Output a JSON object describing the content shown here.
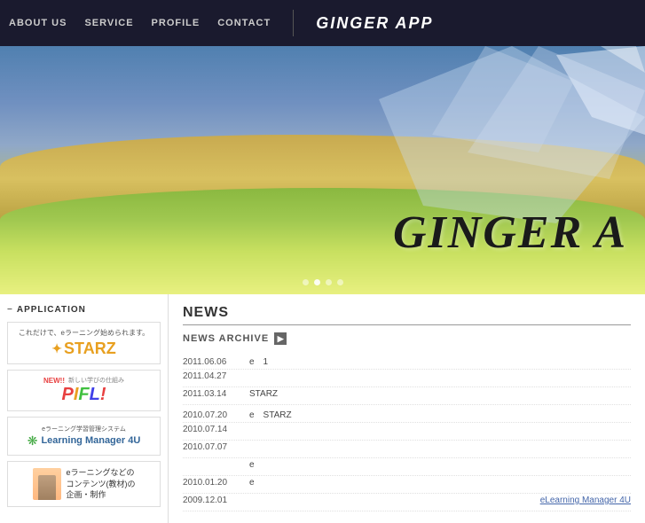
{
  "header": {
    "nav": [
      {
        "label": "ABOUT US",
        "id": "about"
      },
      {
        "label": "SERVICE",
        "id": "service"
      },
      {
        "label": "PROFILE",
        "id": "profile"
      },
      {
        "label": "CONTACT",
        "id": "contact"
      }
    ],
    "brand": "GINGER APP"
  },
  "hero": {
    "text": "GINGER A",
    "dots": [
      false,
      true,
      false,
      false
    ]
  },
  "sidebar": {
    "title": "APPLICATION",
    "apps": [
      {
        "id": "starz",
        "top_text": "これだけで、eラーニング始められます。",
        "logo": "STARZ"
      },
      {
        "id": "pifl",
        "new_label": "NEW!!",
        "sub_text": "新しい学びの仕組み",
        "logo": "PIFL!"
      },
      {
        "id": "learning-manager",
        "top_text": "eラーニング学習管理システム",
        "name": "Learning Manager 4U"
      },
      {
        "id": "content-production",
        "description": "eラーニングなどの\nコンテンツ(教材)の\n企画・制作"
      }
    ]
  },
  "news": {
    "title": "NEWS",
    "archive_label": "NEWS ARCHIVE",
    "archive_icon": "▶",
    "items": [
      {
        "date": "2011.06.06",
        "content": "e　1",
        "link": ""
      },
      {
        "date": "2011.04.27",
        "content": "",
        "link": ""
      },
      {
        "date": "2011.03.14",
        "content": "STARZ",
        "link": ""
      },
      {
        "date": "2010.07.20",
        "content": "e　STARZ",
        "link": ""
      },
      {
        "date": "2010.07.14",
        "content": "",
        "link": ""
      },
      {
        "date": "2010.07.07",
        "content": "",
        "link": ""
      },
      {
        "date": "",
        "content": "e",
        "link": ""
      },
      {
        "date": "2010.01.20",
        "content": "e",
        "link": ""
      },
      {
        "date": "2009.12.01",
        "content": "",
        "link": "eLearning Manager 4U"
      }
    ]
  }
}
